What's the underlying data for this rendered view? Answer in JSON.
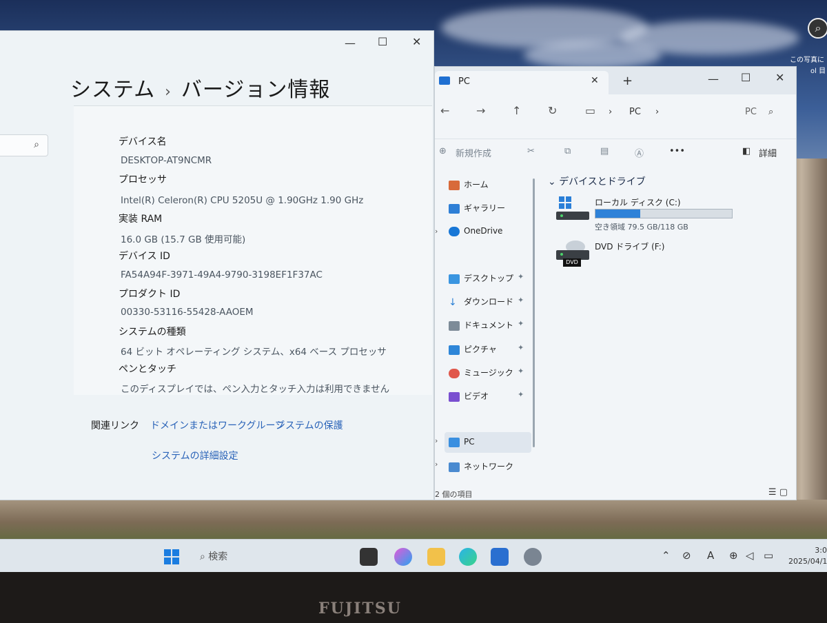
{
  "settings": {
    "title_part1": "システム",
    "title_part2": "バージョン情報",
    "specs": [
      {
        "label": "デバイス名",
        "value": "DESKTOP-AT9NCMR"
      },
      {
        "label": "プロセッサ",
        "value": "Intel(R) Celeron(R) CPU 5205U @ 1.90GHz   1.90 GHz"
      },
      {
        "label": "実装 RAM",
        "value": "16.0 GB (15.7 GB 使用可能)"
      },
      {
        "label": "デバイス ID",
        "value": "FA54A94F-3971-49A4-9790-3198EF1F37AC"
      },
      {
        "label": "プロダクト ID",
        "value": "00330-53116-55428-AAOEM"
      },
      {
        "label": "システムの種類",
        "value": "64 ビット オペレーティング システム、x64 ベース プロセッサ"
      },
      {
        "label": "ペンとタッチ",
        "value": "このディスプレイでは、ペン入力とタッチ入力は利用できません"
      }
    ],
    "related_label": "関連リンク",
    "related_links": [
      "ドメインまたはワークグループ",
      "システムの保護",
      "システムの詳細設定"
    ]
  },
  "explorer": {
    "tab_title": "PC",
    "breadcrumb": "PC",
    "search_placeholder": "PC",
    "new_label": "新規作成",
    "details_label": "詳細",
    "nav_items": [
      {
        "label": "ホーム",
        "icon": "home-icon"
      },
      {
        "label": "ギャラリー",
        "icon": "gallery-icon"
      },
      {
        "label": "OneDrive",
        "icon": "cloud-icon"
      },
      {
        "label": "デスクトップ",
        "icon": "desktop-folder-icon"
      },
      {
        "label": "ダウンロード",
        "icon": "download-icon"
      },
      {
        "label": "ドキュメント",
        "icon": "document-icon"
      },
      {
        "label": "ピクチャ",
        "icon": "pictures-icon"
      },
      {
        "label": "ミュージック",
        "icon": "music-icon"
      },
      {
        "label": "ビデオ",
        "icon": "video-icon"
      },
      {
        "label": "PC",
        "icon": "pc-icon"
      },
      {
        "label": "ネットワーク",
        "icon": "network-icon"
      }
    ],
    "section_title": "デバイスとドライブ",
    "drives": [
      {
        "name": "ローカル ディスク (C:)",
        "free": "空き領域 79.5 GB/118 GB",
        "used_fraction": 0.33
      },
      {
        "name": "DVD ドライブ (F:)",
        "badge": "DVD"
      }
    ],
    "status": "2 個の項目"
  },
  "desktop": {
    "icon_label_line1": "この写真に",
    "icon_label_line2": "ol 目"
  },
  "taskbar": {
    "search_label": "検索",
    "clock_time": "3:0",
    "clock_date": "2025/04/1"
  },
  "bezel": {
    "brand": "FUJITSU"
  }
}
